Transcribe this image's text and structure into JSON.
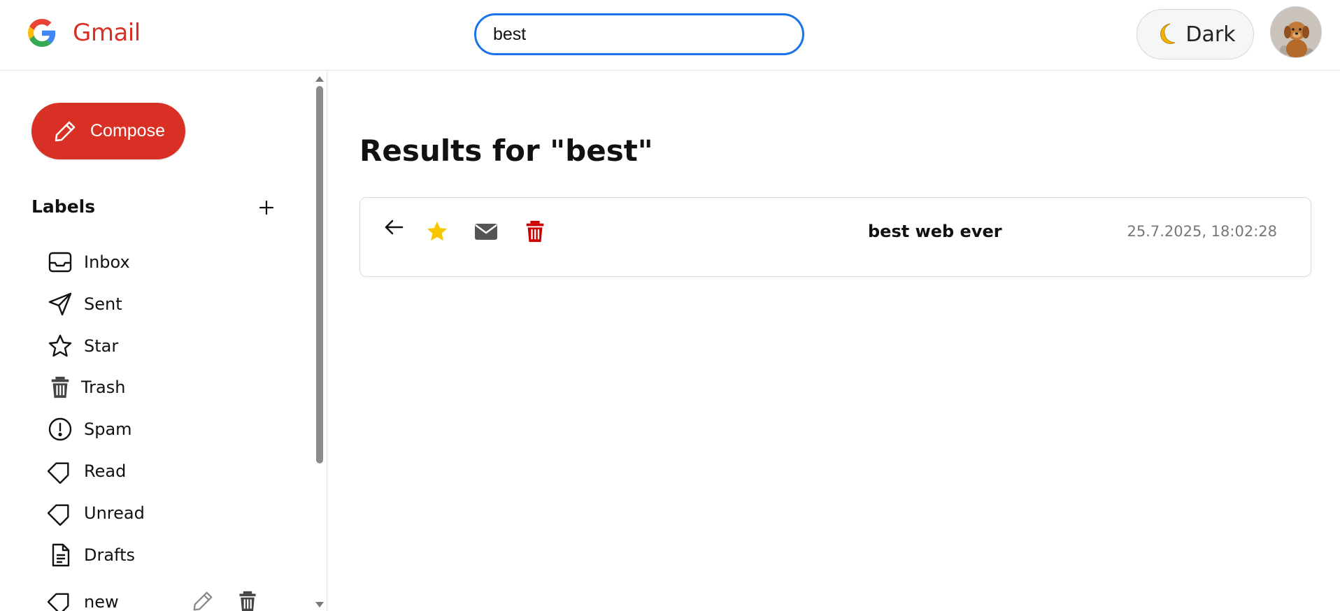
{
  "header": {
    "brand_name": "Gmail",
    "search": {
      "value": "best",
      "placeholder": ""
    },
    "theme_toggle_label": "Dark",
    "colors": {
      "brand": "#d93025",
      "search_border": "#1a73e8"
    }
  },
  "sidebar": {
    "compose_label": "Compose",
    "labels_title": "Labels",
    "add_label_icon": "plus-icon",
    "items": [
      {
        "label": "Inbox",
        "icon": "inbox-icon"
      },
      {
        "label": "Sent",
        "icon": "send-icon"
      },
      {
        "label": "Star",
        "icon": "star-outline-icon"
      },
      {
        "label": "Trash",
        "icon": "trash-icon"
      },
      {
        "label": "Spam",
        "icon": "alert-circle-icon"
      },
      {
        "label": "Read",
        "icon": "tag-icon"
      },
      {
        "label": "Unread",
        "icon": "tag-icon"
      },
      {
        "label": "Drafts",
        "icon": "document-icon"
      },
      {
        "label": "new",
        "icon": "tag-icon"
      }
    ]
  },
  "main": {
    "results_title": "Results for \"best\"",
    "results": [
      {
        "subject": "best web ever",
        "date": "25.7.2025, 18:02:28",
        "starred": true
      }
    ],
    "colors": {
      "star": "#f7c600",
      "trash": "#cc0000",
      "mail": "#555555"
    }
  }
}
